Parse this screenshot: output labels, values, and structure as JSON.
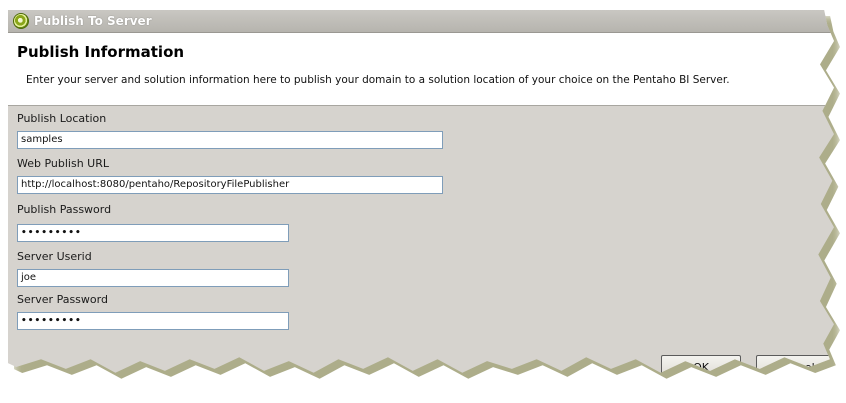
{
  "window": {
    "title": "Publish To Server",
    "icon": "pentaho-logo-icon"
  },
  "banner": {
    "heading": "Publish Information",
    "description": "Enter your server and solution information here to publish your domain to a solution location of your choice on the Pentaho BI Server."
  },
  "form": {
    "publish_location": {
      "label": "Publish Location",
      "value": "samples"
    },
    "web_publish_url": {
      "label": "Web Publish URL",
      "value": "http://localhost:8080/pentaho/RepositoryFilePublisher"
    },
    "publish_password": {
      "label": "Publish Password",
      "value": "•••••••••"
    },
    "server_userid": {
      "label": "Server Userid",
      "value": "joe"
    },
    "server_password": {
      "label": "Server Password",
      "value": "•••••••••"
    }
  },
  "buttons": {
    "ok": "OK",
    "cancel": "Cancel"
  },
  "colors": {
    "dialog_background": "#d6d3ce",
    "banner_background": "#ffffff",
    "input_border": "#7f9db9",
    "torn_edge_shadow": "#6b6b2a"
  }
}
